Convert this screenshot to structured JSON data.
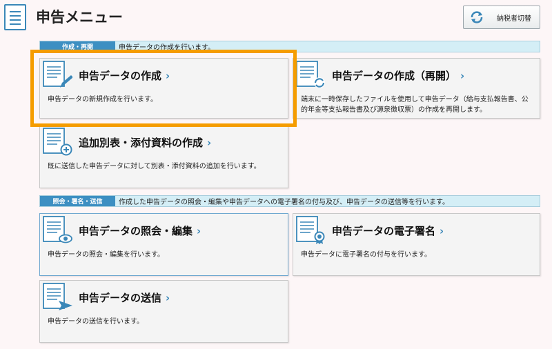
{
  "header": {
    "title": "申告メニュー",
    "switch_button_label": "納税者切替",
    "icons": {
      "page": "document-icon",
      "switch": "refresh-icon"
    }
  },
  "sections": [
    {
      "tag": "作成・再開",
      "description": "申告データの作成を行います。",
      "cards": [
        {
          "title": "申告データの作成",
          "description": "申告データの新規作成を行います。",
          "icon": "document-pencil-icon",
          "focused": true
        },
        {
          "title": "申告データの作成（再開）",
          "description": "端末に一時保存したファイルを使用して申告データ（給与支払報告書、公的年金等支払報告書及び源泉徴収票）の作成を再開します。",
          "icon": "document-refresh-icon"
        },
        {
          "title": "追加別表・添付資料の作成",
          "description": "既に送信した申告データに対して別表・添付資料の追加を行います。",
          "icon": "document-plus-icon"
        }
      ]
    },
    {
      "tag": "照会・署名・送信",
      "description": "作成した申告データの照会・編集や申告データへの電子署名の付与及び、申告データの送信等を行います。",
      "cards": [
        {
          "title": "申告データの照会・編集",
          "description": "申告データの照会・編集を行います。",
          "icon": "document-eye-icon"
        },
        {
          "title": "申告データの電子署名",
          "description": "申告データに電子署名の付与を行います。",
          "icon": "document-seal-icon"
        },
        {
          "title": "申告データの送信",
          "description": "申告データの送信を行います。",
          "icon": "document-send-icon"
        }
      ]
    }
  ],
  "chevron": "›",
  "colors": {
    "accent": "#3d8fc2",
    "focus": "#f59c00",
    "section_bg": "#d4eef6"
  }
}
